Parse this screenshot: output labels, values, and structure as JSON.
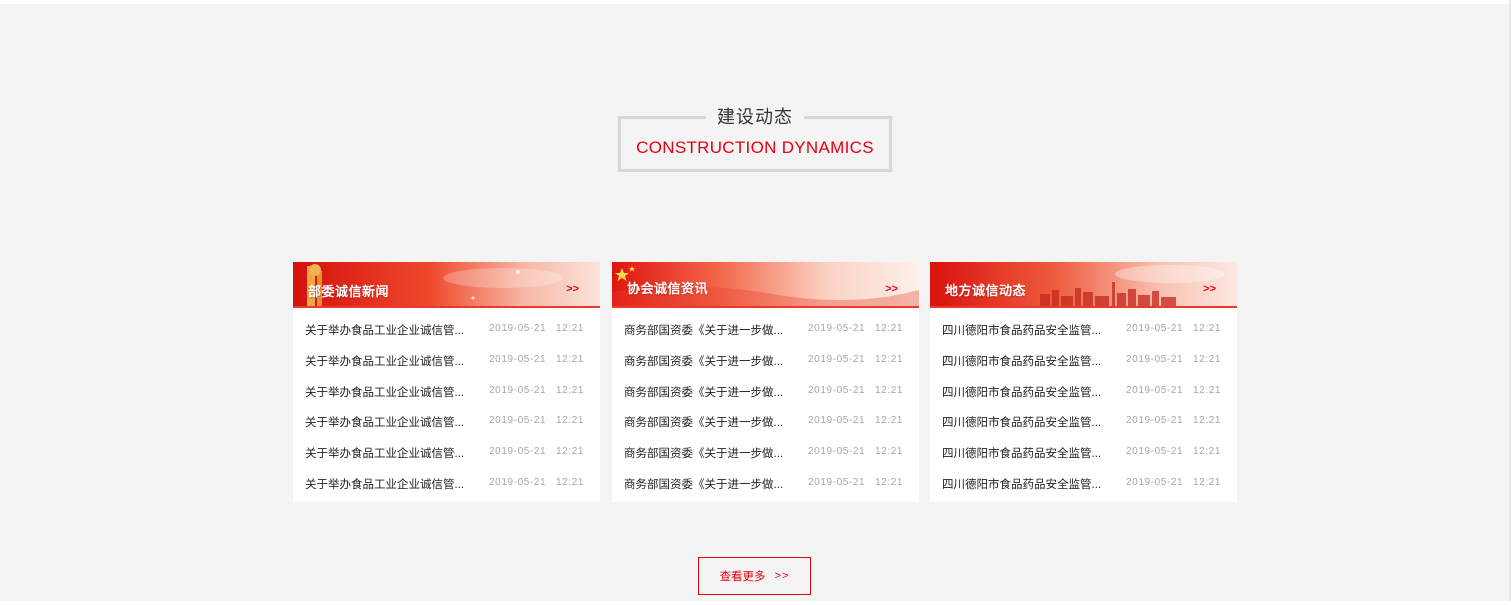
{
  "section": {
    "title_cn": "建设动态",
    "title_en": "CONSTRUCTION DYNAMICS"
  },
  "cards": [
    {
      "title": "部委诚信新闻",
      "more": ">>",
      "items": [
        {
          "title": "关于举办食品工业企业诚信管...",
          "date": "2019-05-21",
          "time": "12:21"
        },
        {
          "title": "关于举办食品工业企业诚信管...",
          "date": "2019-05-21",
          "time": "12:21"
        },
        {
          "title": "关于举办食品工业企业诚信管...",
          "date": "2019-05-21",
          "time": "12:21"
        },
        {
          "title": "关于举办食品工业企业诚信管...",
          "date": "2019-05-21",
          "time": "12:21"
        },
        {
          "title": "关于举办食品工业企业诚信管...",
          "date": "2019-05-21",
          "time": "12:21"
        },
        {
          "title": "关于举办食品工业企业诚信管...",
          "date": "2019-05-21",
          "time": "12:21"
        }
      ]
    },
    {
      "title": "协会诚信资讯",
      "more": ">>",
      "items": [
        {
          "title": "商务部国资委《关于进一步做...",
          "date": "2019-05-21",
          "time": "12:21"
        },
        {
          "title": "商务部国资委《关于进一步做...",
          "date": "2019-05-21",
          "time": "12:21"
        },
        {
          "title": "商务部国资委《关于进一步做...",
          "date": "2019-05-21",
          "time": "12:21"
        },
        {
          "title": "商务部国资委《关于进一步做...",
          "date": "2019-05-21",
          "time": "12:21"
        },
        {
          "title": "商务部国资委《关于进一步做...",
          "date": "2019-05-21",
          "time": "12:21"
        },
        {
          "title": "商务部国资委《关于进一步做...",
          "date": "2019-05-21",
          "time": "12:21"
        }
      ]
    },
    {
      "title": "地方诚信动态",
      "more": ">>",
      "items": [
        {
          "title": "四川德阳市食品药品安全监管...",
          "date": "2019-05-21",
          "time": "12:21"
        },
        {
          "title": "四川德阳市食品药品安全监管...",
          "date": "2019-05-21",
          "time": "12:21"
        },
        {
          "title": "四川德阳市食品药品安全监管...",
          "date": "2019-05-21",
          "time": "12:21"
        },
        {
          "title": "四川德阳市食品药品安全监管...",
          "date": "2019-05-21",
          "time": "12:21"
        },
        {
          "title": "四川德阳市食品药品安全监管...",
          "date": "2019-05-21",
          "time": "12:21"
        },
        {
          "title": "四川德阳市食品药品安全监管...",
          "date": "2019-05-21",
          "time": "12:21"
        }
      ]
    }
  ],
  "more_button": {
    "label": "查看更多",
    "arrow": ">>"
  },
  "colors": {
    "accent": "#e60012",
    "background": "#f4f4f4",
    "title_border": "#d7d7d7"
  },
  "icons": [
    "party-emblem-icon",
    "flag-star-icon",
    "city-skyline-icon"
  ]
}
